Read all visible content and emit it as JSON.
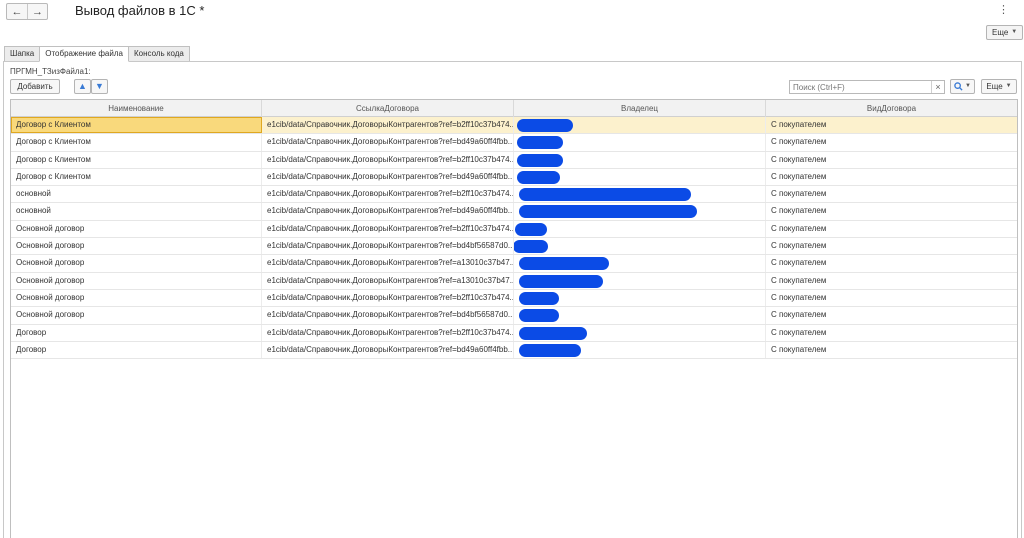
{
  "window": {
    "title": "Вывод файлов в 1С *",
    "back_icon": "←",
    "forward_icon": "→",
    "menu_icon": "⋮",
    "more_label": "Еще"
  },
  "tabs": [
    {
      "label": "Шапка",
      "active": false
    },
    {
      "label": "Отображение файла",
      "active": true
    },
    {
      "label": "Консоль кода",
      "active": false
    }
  ],
  "form": {
    "table_label": "ПРГМН_ТЗизФайла1:",
    "add_label": "Добавить",
    "up_icon": "🡅",
    "down_icon": "🡇",
    "search_placeholder": "Поиск (Ctrl+F)",
    "clear_icon": "×",
    "search_icon": "🔍",
    "more_label": "Еще"
  },
  "table": {
    "columns": [
      "Наименование",
      "СсылкаДоговора",
      "Владелец",
      "ВидДоговора"
    ],
    "rows": [
      {
        "name": "Договор с Клиентом",
        "ref": "e1cib/data/Справочник.ДоговорыКонтрагентов?ref=b2ff10c37b474...",
        "owner": "",
        "kind": "С покупателем"
      },
      {
        "name": "Договор с Клиентом",
        "ref": "e1cib/data/Справочник.ДоговорыКонтрагентов?ref=bd49a60ff4fbb...",
        "owner": "",
        "kind": "С покупателем"
      },
      {
        "name": "Договор с Клиентом",
        "ref": "e1cib/data/Справочник.ДоговорыКонтрагентов?ref=b2ff10c37b474...",
        "owner": "",
        "kind": "С покупателем"
      },
      {
        "name": "Договор с Клиентом",
        "ref": "e1cib/data/Справочник.ДоговорыКонтрагентов?ref=bd49a60ff4fbb...",
        "owner": "",
        "kind": "С покупателем"
      },
      {
        "name": "основной",
        "ref": "e1cib/data/Справочник.ДоговорыКонтрагентов?ref=b2ff10c37b474...",
        "owner": "",
        "kind": "С покупателем"
      },
      {
        "name": "основной",
        "ref": "e1cib/data/Справочник.ДоговорыКонтрагентов?ref=bd49a60ff4fbb...",
        "owner": "",
        "kind": "С покупателем"
      },
      {
        "name": "Основной договор",
        "ref": "e1cib/data/Справочник.ДоговорыКонтрагентов?ref=b2ff10c37b474...",
        "owner": "",
        "kind": "С покупателем"
      },
      {
        "name": "Основной договор",
        "ref": "e1cib/data/Справочник.ДоговорыКонтрагентов?ref=bd4bf56587d0...",
        "owner": "",
        "kind": "С покупателем"
      },
      {
        "name": "Основной договор",
        "ref": "e1cib/data/Справочник.ДоговорыКонтрагентов?ref=a13010c37b47...",
        "owner": "",
        "kind": "С покупателем"
      },
      {
        "name": "Основной договор",
        "ref": "e1cib/data/Справочник.ДоговорыКонтрагентов?ref=a13010c37b47...",
        "owner": "",
        "kind": "С покупателем"
      },
      {
        "name": "Основной договор",
        "ref": "e1cib/data/Справочник.ДоговорыКонтрагентов?ref=b2ff10c37b474...",
        "owner": "",
        "kind": "С покупателем"
      },
      {
        "name": "Основной договор",
        "ref": "e1cib/data/Справочник.ДоговорыКонтрагентов?ref=bd4bf56587d0...",
        "owner": "",
        "kind": "С покупателем"
      },
      {
        "name": "Договор",
        "ref": "e1cib/data/Справочник.ДоговорыКонтрагентов?ref=b2ff10c37b474...",
        "owner": "",
        "kind": "С покупателем"
      },
      {
        "name": "Договор",
        "ref": "e1cib/data/Справочник.ДоговорыКонтрагентов?ref=bd49a60ff4fbb...",
        "owner": "",
        "kind": "С покупателем"
      }
    ]
  },
  "colors": {
    "selected_row": "#fcf1cd",
    "selected_cell": "#f9d97c",
    "redaction": "#0b4be6",
    "accent": "#3a7bd5"
  }
}
